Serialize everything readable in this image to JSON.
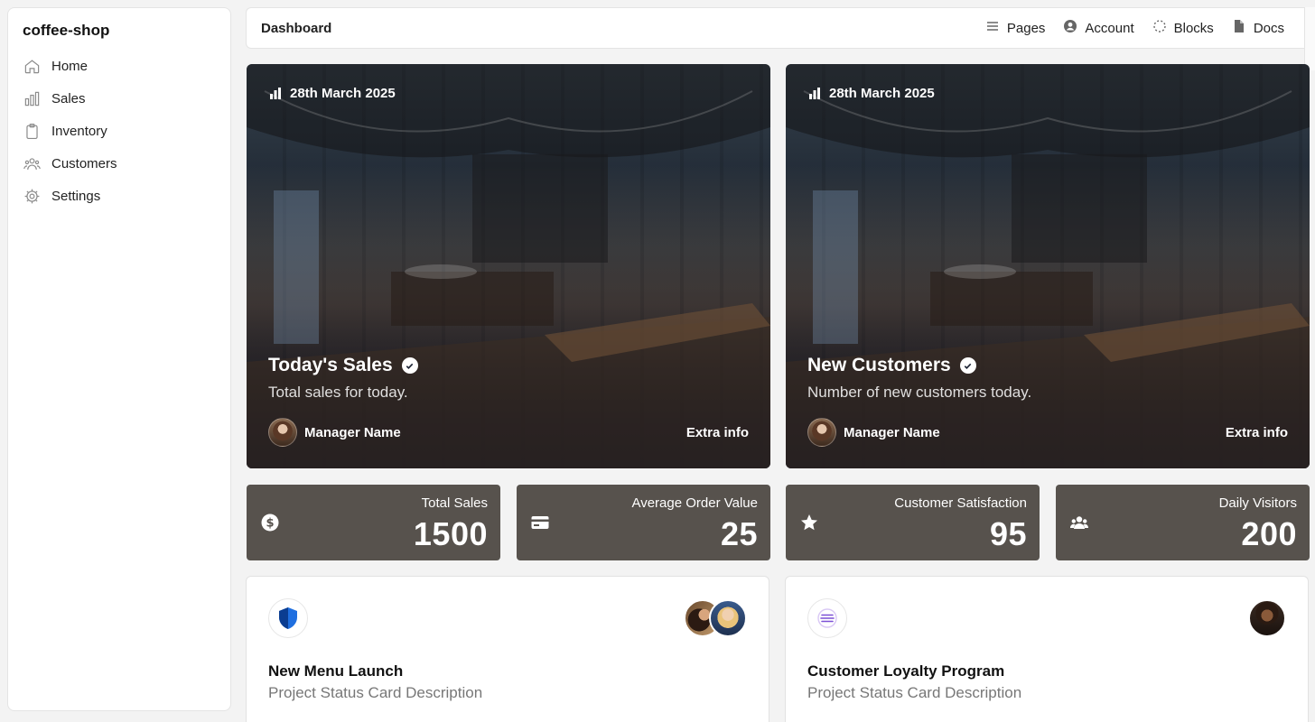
{
  "app": {
    "name": "coffee-shop"
  },
  "sidebar": {
    "items": [
      {
        "label": "Home",
        "icon": "home-icon"
      },
      {
        "label": "Sales",
        "icon": "bar-chart-icon"
      },
      {
        "label": "Inventory",
        "icon": "clipboard-icon"
      },
      {
        "label": "Customers",
        "icon": "users-icon"
      },
      {
        "label": "Settings",
        "icon": "gear-icon"
      }
    ]
  },
  "topbar": {
    "title": "Dashboard",
    "nav": [
      {
        "label": "Pages",
        "icon": "list-icon"
      },
      {
        "label": "Account",
        "icon": "user-circle-icon"
      },
      {
        "label": "Blocks",
        "icon": "dotted-circle-icon"
      },
      {
        "label": "Docs",
        "icon": "document-icon"
      }
    ]
  },
  "heroes": [
    {
      "date": "28th March 2025",
      "title": "Today's Sales",
      "subtitle": "Total sales for today.",
      "manager": "Manager Name",
      "extra": "Extra info"
    },
    {
      "date": "28th March 2025",
      "title": "New Customers",
      "subtitle": "Number of new customers today.",
      "manager": "Manager Name",
      "extra": "Extra info"
    }
  ],
  "stats": [
    {
      "label": "Total Sales",
      "value": "1500",
      "icon": "dollar-circle-icon"
    },
    {
      "label": "Average Order Value",
      "value": "25",
      "icon": "credit-card-icon"
    },
    {
      "label": "Customer Satisfaction",
      "value": "95",
      "icon": "star-icon"
    },
    {
      "label": "Daily Visitors",
      "value": "200",
      "icon": "users-icon"
    }
  ],
  "projects": [
    {
      "title": "New Menu Launch",
      "description": "Project Status Card Description",
      "logo": "shield-icon"
    },
    {
      "title": "Customer Loyalty Program",
      "description": "Project Status Card Description",
      "logo": "coin-stack-icon"
    }
  ],
  "colors": {
    "stat_bg": "#57524d",
    "accent_blue": "#1f6fe0",
    "accent_purple": "#7b4fd6"
  }
}
